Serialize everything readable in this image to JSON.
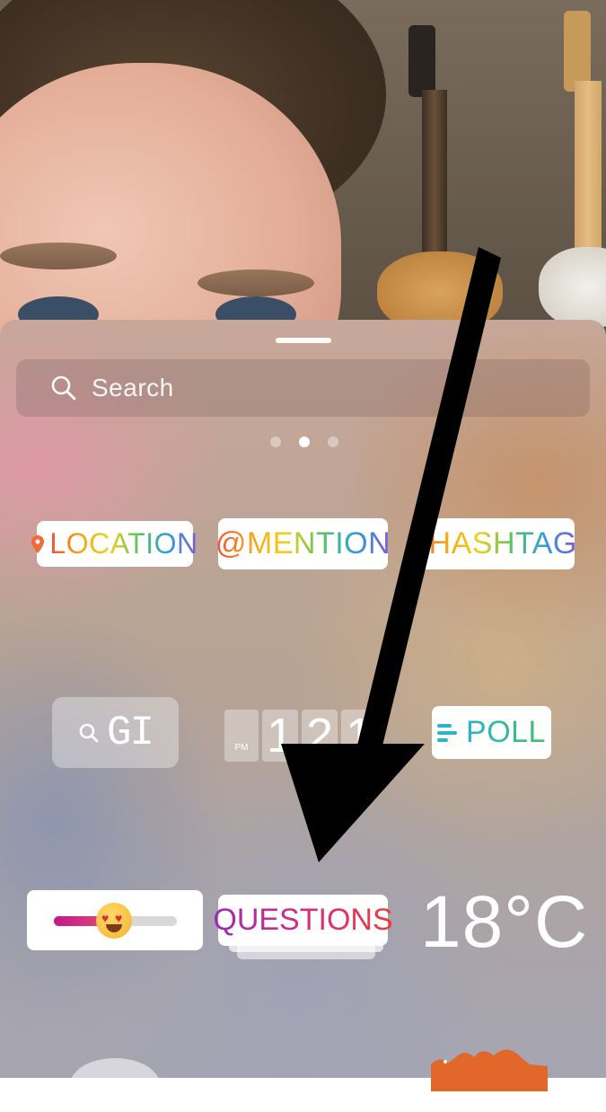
{
  "search": {
    "placeholder": "Search"
  },
  "pagination": {
    "count": 3,
    "active_index": 1
  },
  "stickers": {
    "location": "LOCATION",
    "mention": "@MENTION",
    "hashtag": "#HASHTAG",
    "gif": "GI",
    "clock": {
      "meridiem": "PM",
      "digits": [
        "1",
        "2",
        "1"
      ]
    },
    "poll": "POLL",
    "questions": "QUESTIONS",
    "temperature": "18°C",
    "slider": {
      "level": 0.45
    }
  },
  "icons": {
    "search": "search-icon",
    "location_pin": "location-pin-icon",
    "poll_lines": "poll-lines-icon",
    "heart_eyes": "heart-eyes-emoji-icon",
    "camel": "camel-icon"
  },
  "colors": {
    "location_pin": "#f06a3a",
    "poll_lines": "#2bb3c9",
    "slider_fill": "#c1168a",
    "arrow": "#000000"
  }
}
